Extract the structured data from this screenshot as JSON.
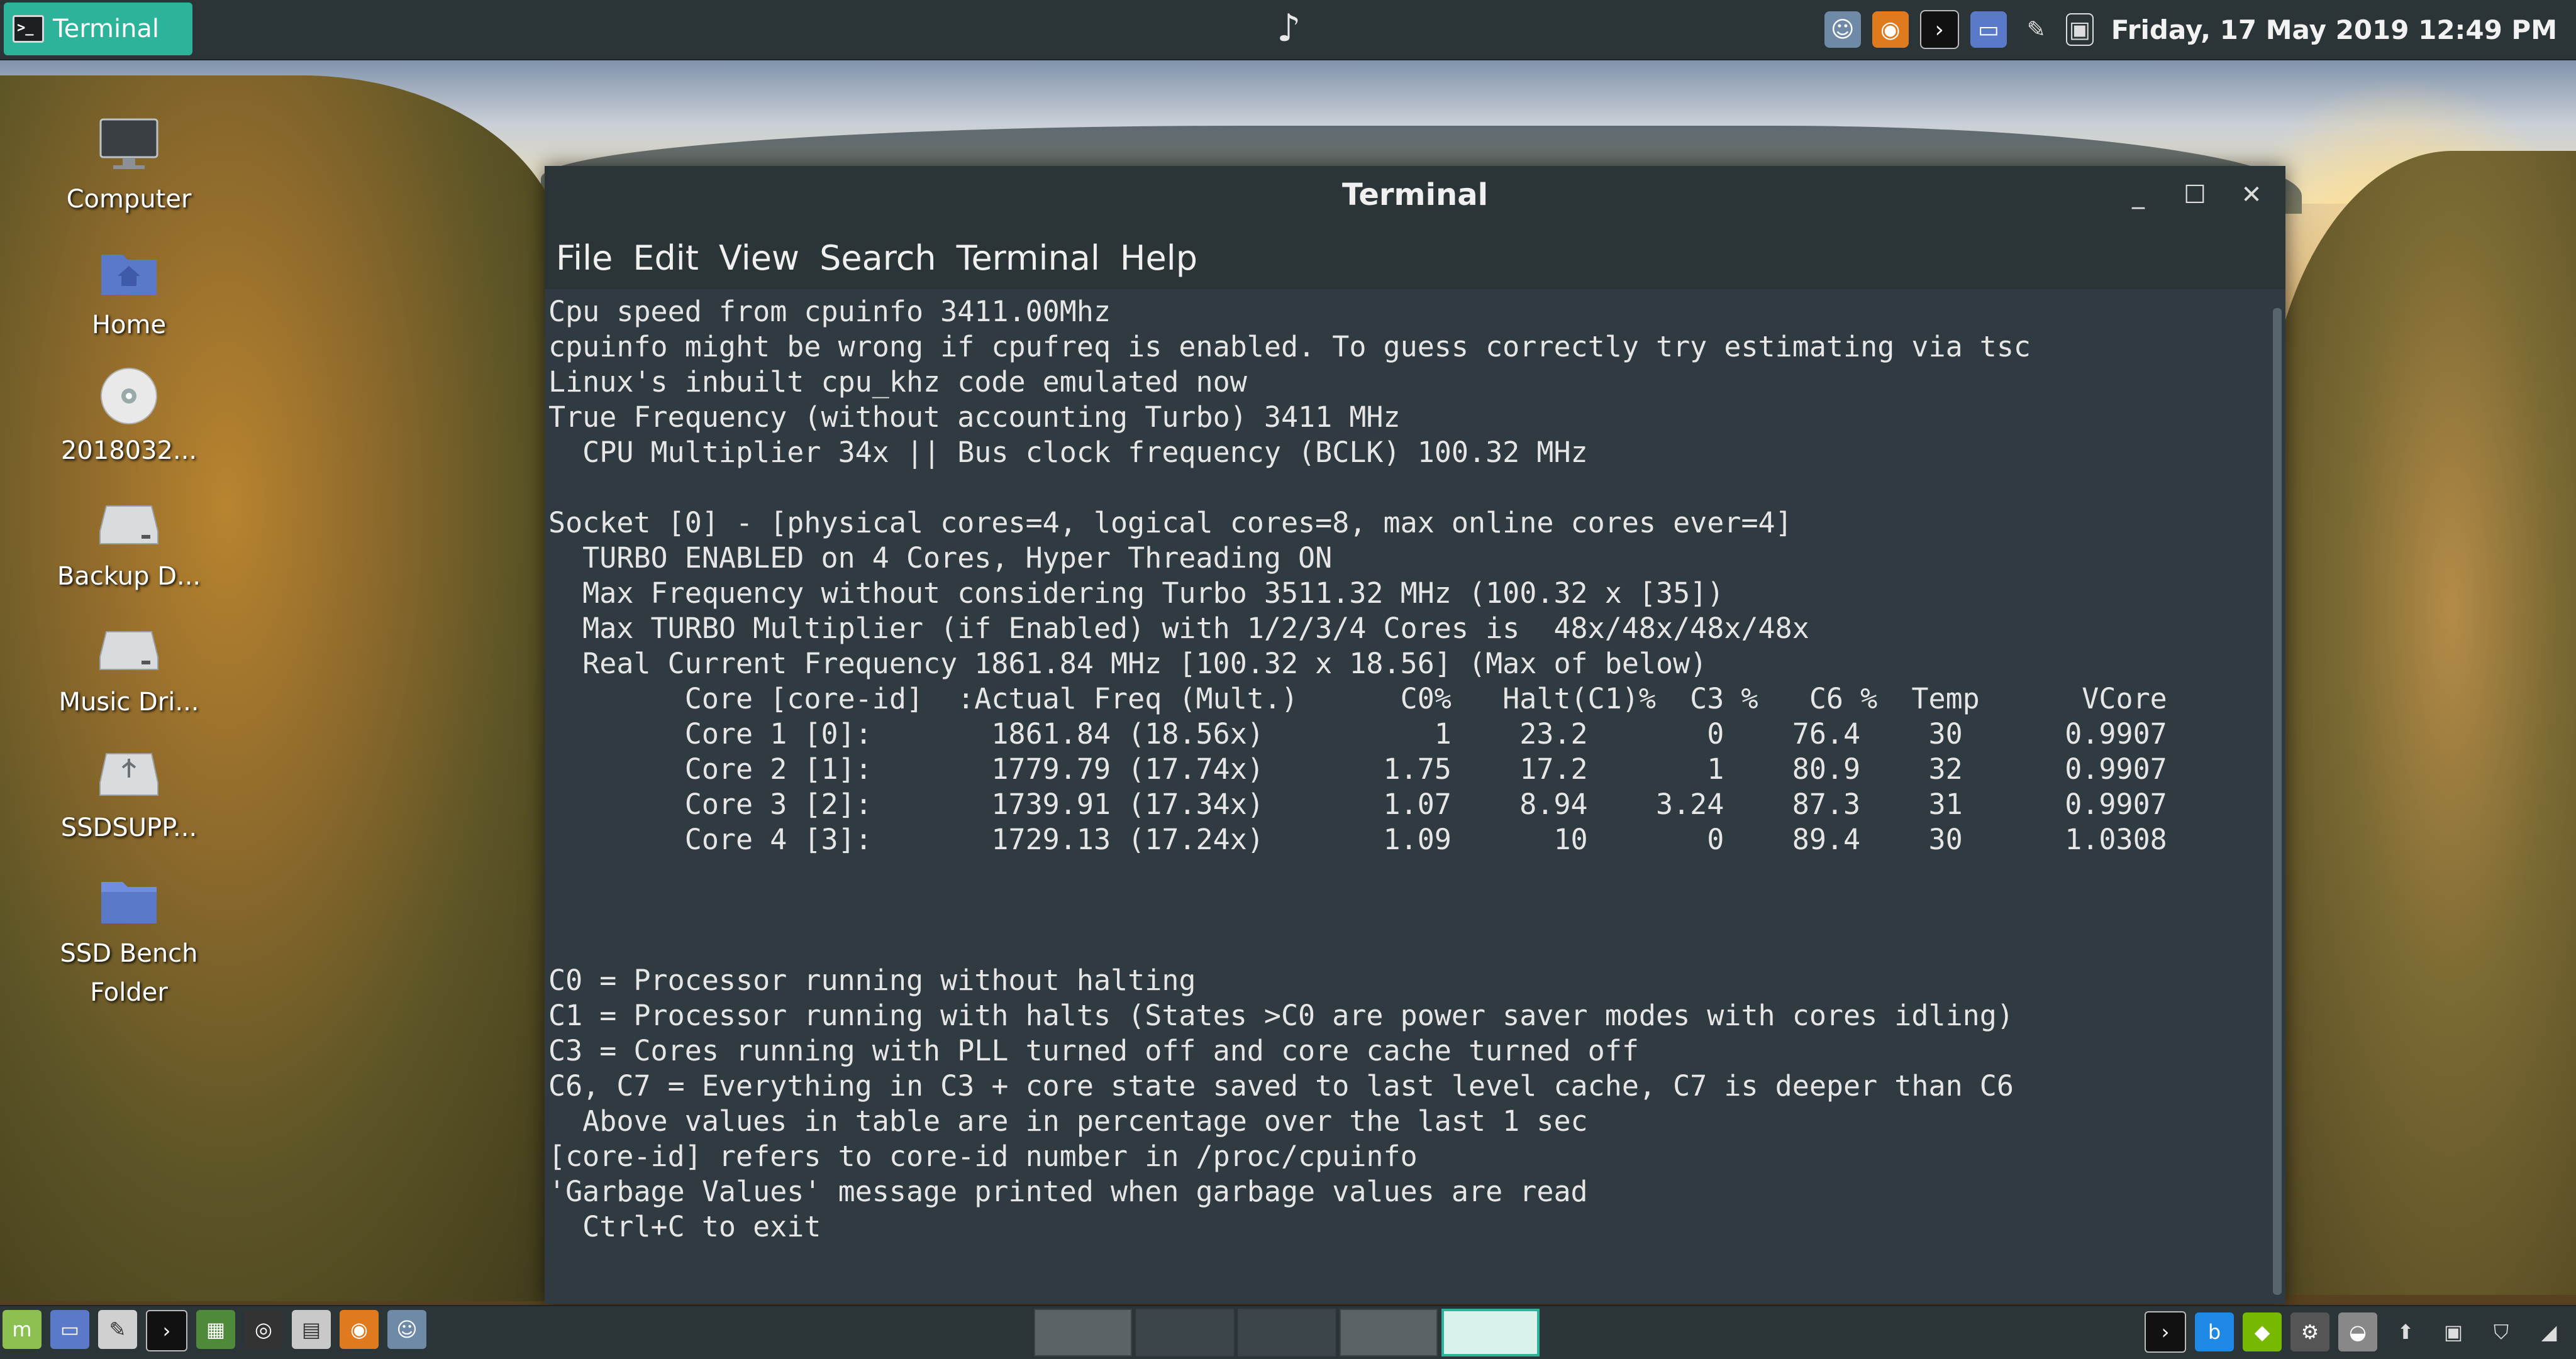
{
  "top_panel": {
    "task_label": "Terminal",
    "clock": "Friday, 17 May 2019 12:49 PM",
    "tray_icons": [
      "people-icon",
      "firefox-icon",
      "terminal-icon",
      "folder-icon",
      "pen-icon",
      "screenshot-icon"
    ]
  },
  "desktop": {
    "items": [
      {
        "label": "Computer",
        "icon": "computer-icon"
      },
      {
        "label": "Home",
        "icon": "home-folder-icon"
      },
      {
        "label": "2018032...",
        "icon": "disc-icon"
      },
      {
        "label": "Backup D...",
        "icon": "drive-icon"
      },
      {
        "label": "Music Dri...",
        "icon": "drive-icon"
      },
      {
        "label": "SSDSUPP...",
        "icon": "usb-drive-icon"
      },
      {
        "label": "SSD Bench",
        "label2": "Folder",
        "icon": "folder-icon"
      }
    ]
  },
  "window": {
    "title": "Terminal",
    "menu": [
      "File",
      "Edit",
      "View",
      "Search",
      "Terminal",
      "Help"
    ],
    "lines": [
      "Cpu speed from cpuinfo 3411.00Mhz",
      "cpuinfo might be wrong if cpufreq is enabled. To guess correctly try estimating via tsc",
      "Linux's inbuilt cpu_khz code emulated now",
      "True Frequency (without accounting Turbo) 3411 MHz",
      "  CPU Multiplier 34x || Bus clock frequency (BCLK) 100.32 MHz",
      "",
      "Socket [0] - [physical cores=4, logical cores=8, max online cores ever=4]",
      "  TURBO ENABLED on 4 Cores, Hyper Threading ON",
      "  Max Frequency without considering Turbo 3511.32 MHz (100.32 x [35])",
      "  Max TURBO Multiplier (if Enabled) with 1/2/3/4 Cores is  48x/48x/48x/48x",
      "  Real Current Frequency 1861.84 MHz [100.32 x 18.56] (Max of below)",
      "        Core [core-id]  :Actual Freq (Mult.)      C0%   Halt(C1)%  C3 %   C6 %  Temp      VCore",
      "        Core 1 [0]:       1861.84 (18.56x)          1    23.2       0    76.4    30      0.9907",
      "        Core 2 [1]:       1779.79 (17.74x)       1.75    17.2       1    80.9    32      0.9907",
      "        Core 3 [2]:       1739.91 (17.34x)       1.07    8.94    3.24    87.3    31      0.9907",
      "        Core 4 [3]:       1729.13 (17.24x)       1.09      10       0    89.4    30      1.0308",
      "",
      "",
      "",
      "C0 = Processor running without halting",
      "C1 = Processor running with halts (States >C0 are power saver modes with cores idling)",
      "C3 = Cores running with PLL turned off and core cache turned off",
      "C6, C7 = Everything in C3 + core state saved to last level cache, C7 is deeper than C6",
      "  Above values in table are in percentage over the last 1 sec",
      "[core-id] refers to core-id number in /proc/cpuinfo",
      "'Garbage Values' message printed when garbage values are read",
      "  Ctrl+C to exit"
    ]
  },
  "bottom_panel": {
    "launchers": [
      "mint-menu-icon",
      "files-icon",
      "text-editor-icon",
      "terminal-icon",
      "system-monitor-icon",
      "disc-burner-icon",
      "archive-icon",
      "firefox-icon",
      "screenshot-icon"
    ],
    "workspaces": 5,
    "active_workspace": 5,
    "tray_icons": [
      "terminal-icon",
      "bing-icon",
      "nvidia-icon",
      "settings-icon",
      "disk-pro-icon",
      "upload-icon",
      "usb-icon",
      "shield-icon",
      "network-icon"
    ]
  },
  "colors": {
    "panel": "#2b3437",
    "accent": "#2cb39a",
    "terminal_bg": "#2f3b40",
    "terminal_text": "#e6e6e6"
  }
}
